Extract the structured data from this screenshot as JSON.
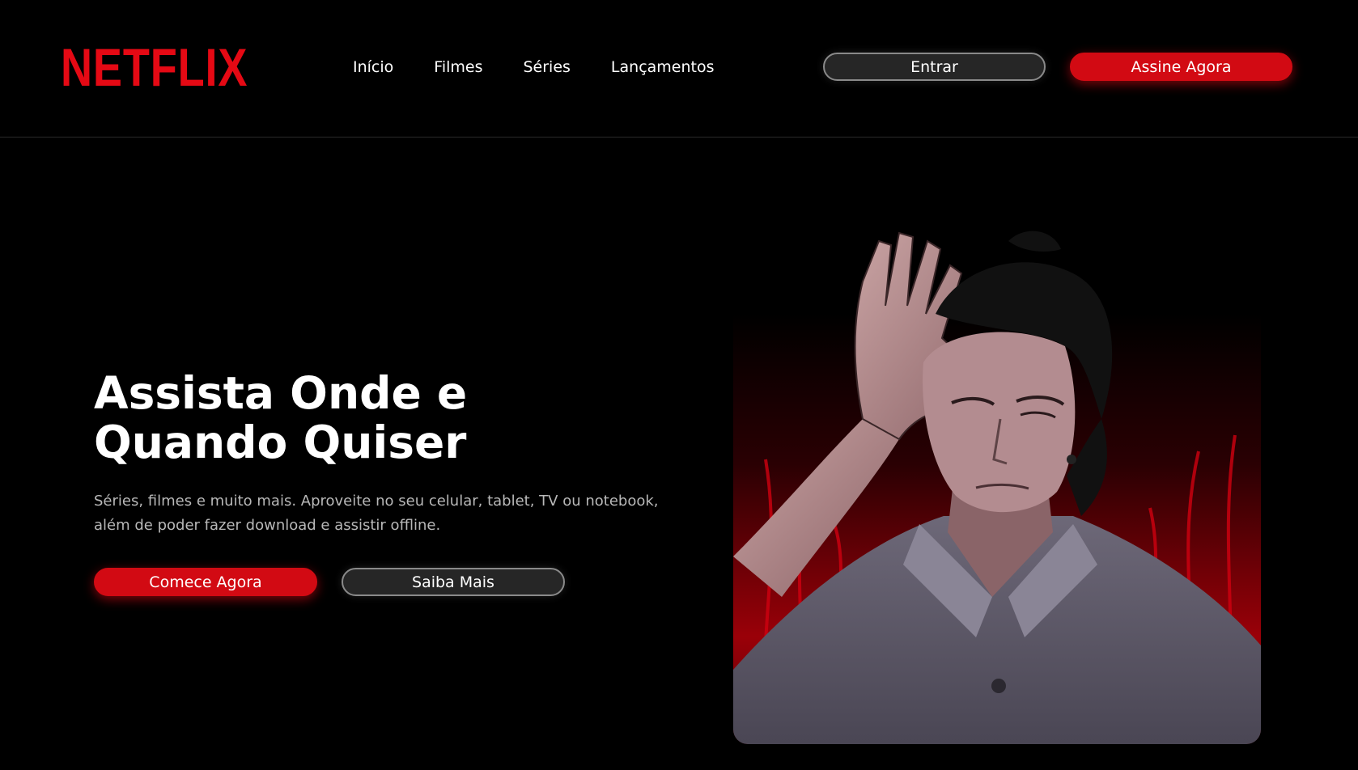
{
  "header": {
    "logo": "NETFLIX",
    "nav": [
      "Início",
      "Filmes",
      "Séries",
      "Lançamentos"
    ],
    "login_label": "Entrar",
    "subscribe_label": "Assine Agora"
  },
  "hero": {
    "title": "Assista Onde e Quando Quiser",
    "description": "Séries, filmes e muito mais. Aproveite no seu celular, tablet, TV ou notebook, além de poder fazer download e assistir offline.",
    "primary_cta": "Comece Agora",
    "secondary_cta": "Saiba Mais"
  },
  "colors": {
    "brand": "#e50914",
    "button_red": "#d20a13",
    "background": "#000000",
    "button_dark": "#262626"
  }
}
